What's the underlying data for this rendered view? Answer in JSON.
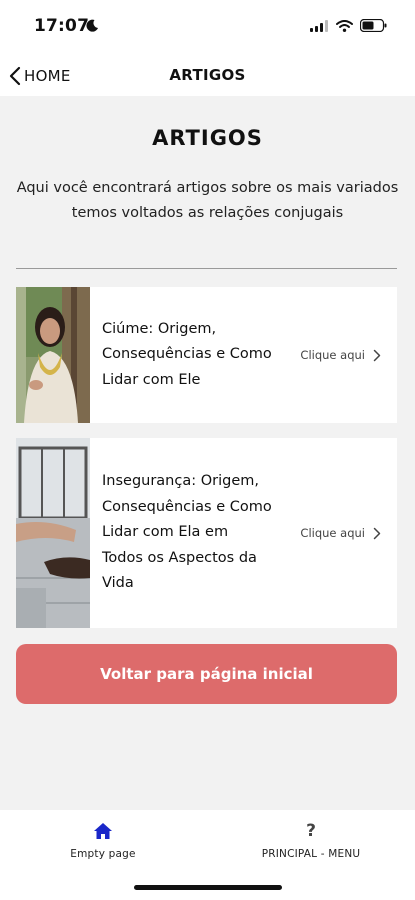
{
  "status_bar": {
    "time": "17:07"
  },
  "nav": {
    "back_label": "HOME",
    "title": "ARTIGOS"
  },
  "page": {
    "title": "ARTIGOS",
    "subtitle": "Aqui você encontrará artigos sobre os mais variados temos voltados as relações conjugais"
  },
  "articles": [
    {
      "title": "Ciúme: Origem, Consequências e Como Lidar com Ele",
      "link_label": "Clique aqui"
    },
    {
      "title": "Insegurança: Origem, Consequências e Como Lidar com Ela em Todos os Aspectos da Vida",
      "link_label": "Clique aqui"
    }
  ],
  "primary_button": {
    "label": "Voltar para página inicial",
    "color": "#dd6b6b"
  },
  "tab_bar": {
    "tabs": [
      {
        "label": "Empty page",
        "icon": "home-icon",
        "color": "#1a27c9"
      },
      {
        "label": "PRINCIPAL - MENU",
        "icon": "question-icon"
      }
    ]
  }
}
